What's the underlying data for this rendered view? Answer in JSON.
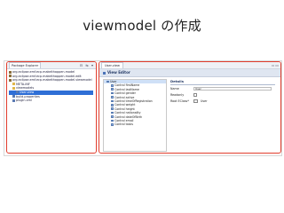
{
  "slide": {
    "title": "viewmodel の作成"
  },
  "package_explorer": {
    "tab_label": "Package Explorer",
    "toolbar_glyphs": "⊟ ⇆ ▾",
    "items": [
      {
        "label": "org.eclipse.emf.ecp.makeithappen.model",
        "kind": "project"
      },
      {
        "label": "org.eclipse.emf.ecp.makeithappen.model.edit",
        "kind": "project"
      },
      {
        "label": "org.eclipse.emf.ecp.makeithappen.model.viewmodel",
        "kind": "project"
      },
      {
        "label": "META-INF",
        "kind": "folder"
      },
      {
        "label": "viewmodels",
        "kind": "folder"
      },
      {
        "label": "User.view",
        "kind": "file"
      },
      {
        "label": "build.properties",
        "kind": "file"
      },
      {
        "label": "plugin.xml",
        "kind": "file"
      }
    ],
    "selected_index": 5
  },
  "editor": {
    "tab_label": "User.view",
    "header_title": "View Editor",
    "tree_root": "User",
    "controls": [
      "Control firstName",
      "Control lastName",
      "Control gender",
      "Control active",
      "Control timeOfRegistration",
      "Control weight",
      "Control height",
      "Control nationality",
      "Control dateOfBirth",
      "Control email",
      "Control tasks"
    ],
    "details": {
      "section_title": "Details",
      "name_label": "Name",
      "name_value": "User",
      "readonly_label": "Readonly",
      "root_eclass_label": "Root EClass*",
      "root_eclass_value": "User"
    }
  }
}
